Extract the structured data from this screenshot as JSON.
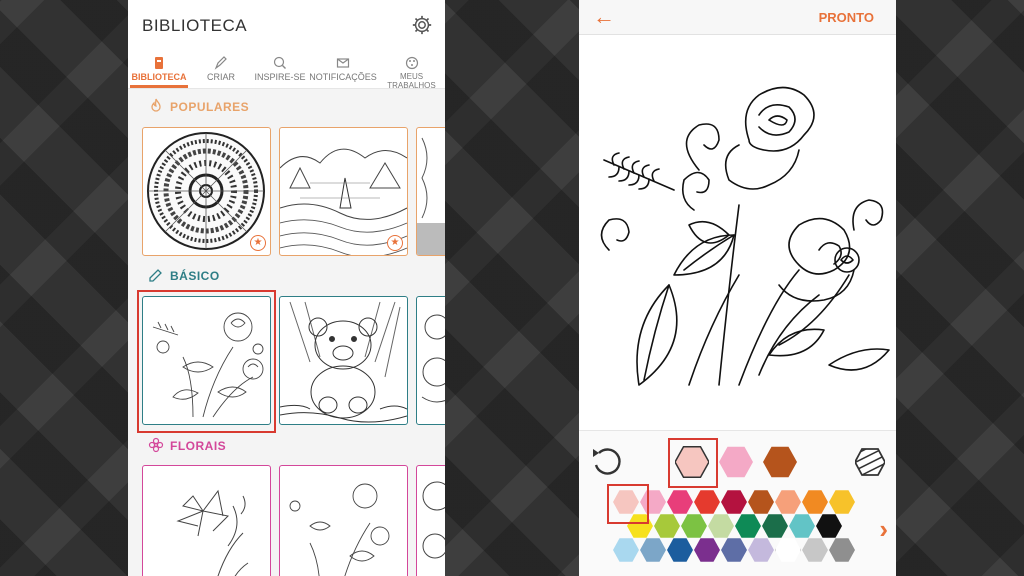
{
  "library": {
    "title": "BIBLIOTECA",
    "tabs": [
      {
        "label": "BIBLIOTECA",
        "active": true,
        "icon": "book-icon"
      },
      {
        "label": "CRIAR",
        "active": false,
        "icon": "pencil-icon"
      },
      {
        "label": "INSPIRE-SE",
        "active": false,
        "icon": "search-heart-icon"
      },
      {
        "label": "NOTIFICAÇÕES",
        "active": false,
        "icon": "envelope-icon"
      },
      {
        "label": "MEUS TRABALHOS",
        "active": false,
        "icon": "palette-icon"
      }
    ],
    "sections": [
      {
        "title": "POPULARES",
        "color": "#e8a36a",
        "icon": "flame-icon"
      },
      {
        "title": "BÁSICO",
        "color": "#2e7e86",
        "icon": "crayon-icon"
      },
      {
        "title": "FLORAIS",
        "color": "#d3479a",
        "icon": "flower-icon"
      }
    ],
    "badge_symbol": "★"
  },
  "editor": {
    "back_symbol": "←",
    "done_label": "PRONTO",
    "undo_icon": "undo-icon",
    "fill_icon": "striped-hex-icon",
    "next_symbol": "›",
    "recent_colors": [
      "#f6c6c0",
      "#f4a9c6",
      "#b5541c"
    ],
    "selected_color": "#f6c6c0",
    "palette_rows": [
      [
        "#f6c6c0",
        "#f4a9c6",
        "#e83e7a",
        "#e53a2e",
        "#b4123f",
        "#b5541c",
        "#f6a07a",
        "#f18a22",
        "#f7c22a"
      ],
      [
        "#f6e11e",
        "#a7c93a",
        "#7cc243",
        "#c4dba2",
        "#0e8a56",
        "#1b6e4a",
        "#62c4c6",
        "#111111"
      ],
      [
        "#a9d8ef",
        "#7ca6c8",
        "#1c5d9e",
        "#7b2f8e",
        "#5e6ea6",
        "#c4b9dd",
        "#ffffff",
        "#c7c7c7",
        "#8f8f8f"
      ]
    ]
  }
}
